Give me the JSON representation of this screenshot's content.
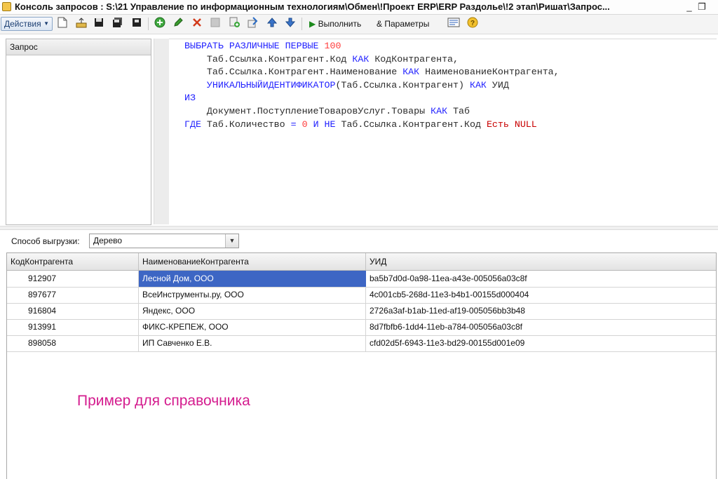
{
  "window": {
    "title": "Консоль запросов : S:\\21 Управление по информационным технологиям\\Обмен\\!Проект ERP\\ERP Раздолье\\!2 этап\\Ришат\\Запрос...",
    "minimize_glyph": "_",
    "restore_glyph": "❐"
  },
  "toolbar": {
    "actions_label": "Действия",
    "run_label": "Выполнить",
    "params_label": "Параметры",
    "params_amp": "&",
    "icons": [
      "new-icon",
      "open-icon",
      "save-icon",
      "save-as-icon",
      "save-all-icon",
      "add-icon",
      "edit-icon",
      "delete-icon",
      "disabled-icon",
      "add-copy-icon",
      "up-icon",
      "down-icon",
      "run-icon",
      "query-builder-icon",
      "help-icon"
    ],
    "accent_color": "#1c3f73"
  },
  "query_panel": {
    "header": "Запрос"
  },
  "editor": {
    "lines": [
      [
        {
          "t": "ВЫБРАТЬ РАЗЛИЧНЫЕ ПЕРВЫЕ ",
          "c": "kw"
        },
        {
          "t": "100",
          "c": "num"
        }
      ],
      [
        {
          "t": "    Таб.Ссылка.Контрагент.Код ",
          "c": "tx"
        },
        {
          "t": "КАК",
          "c": "kw"
        },
        {
          "t": " КодКонтрагента,",
          "c": "tx"
        }
      ],
      [
        {
          "t": "    Таб.Ссылка.Контрагент.Наименование ",
          "c": "tx"
        },
        {
          "t": "КАК",
          "c": "kw"
        },
        {
          "t": " НаименованиеКонтрагента,",
          "c": "tx"
        }
      ],
      [
        {
          "t": "    УНИКАЛЬНЫЙИДЕНТИФИКАТОР",
          "c": "kw"
        },
        {
          "t": "(Таб.Ссылка.Контрагент) ",
          "c": "tx"
        },
        {
          "t": "КАК",
          "c": "kw"
        },
        {
          "t": " УИД",
          "c": "tx"
        }
      ],
      [
        {
          "t": "ИЗ",
          "c": "kw"
        }
      ],
      [
        {
          "t": "    Документ.ПоступлениеТоваровУслуг.Товары ",
          "c": "tx"
        },
        {
          "t": "КАК",
          "c": "kw"
        },
        {
          "t": " Таб",
          "c": "tx"
        }
      ],
      [
        {
          "t": "ГДЕ",
          "c": "kw"
        },
        {
          "t": " Таб.Количество ",
          "c": "tx"
        },
        {
          "t": "=",
          "c": "kw"
        },
        {
          "t": " ",
          "c": "tx"
        },
        {
          "t": "0",
          "c": "num"
        },
        {
          "t": " ",
          "c": "tx"
        },
        {
          "t": "И НЕ",
          "c": "kw"
        },
        {
          "t": " Таб.Ссылка.Контрагент.Код ",
          "c": "tx"
        },
        {
          "t": "Есть NULL",
          "c": "rd"
        }
      ]
    ]
  },
  "export": {
    "label": "Способ выгрузки:",
    "value": "Дерево"
  },
  "table": {
    "columns": [
      "КодКонтрагента",
      "НаименованиеКонтрагента",
      "УИД"
    ],
    "rows": [
      [
        "912907",
        "Лесной Дом, ООО",
        "ba5b7d0d-0a98-11ea-a43e-005056a03c8f"
      ],
      [
        "897677",
        "ВсеИнструменты.ру, ООО",
        "4c001cb5-268d-11e3-b4b1-00155d000404"
      ],
      [
        "916804",
        "Яндекс, ООО",
        "2726a3af-b1ab-11ed-af19-005056bb3b48"
      ],
      [
        "913991",
        "ФИКС-КРЕПЕЖ, ООО",
        "8d7fbfb6-1dd4-11eb-a784-005056a03c8f"
      ],
      [
        "898058",
        "ИП Савченко Е.В.",
        "cfd02d5f-6943-11e3-bd29-00155d001e09"
      ]
    ],
    "selected_row": 0,
    "selection_color": "#3d66c4"
  },
  "caption": "Пример для справочника"
}
